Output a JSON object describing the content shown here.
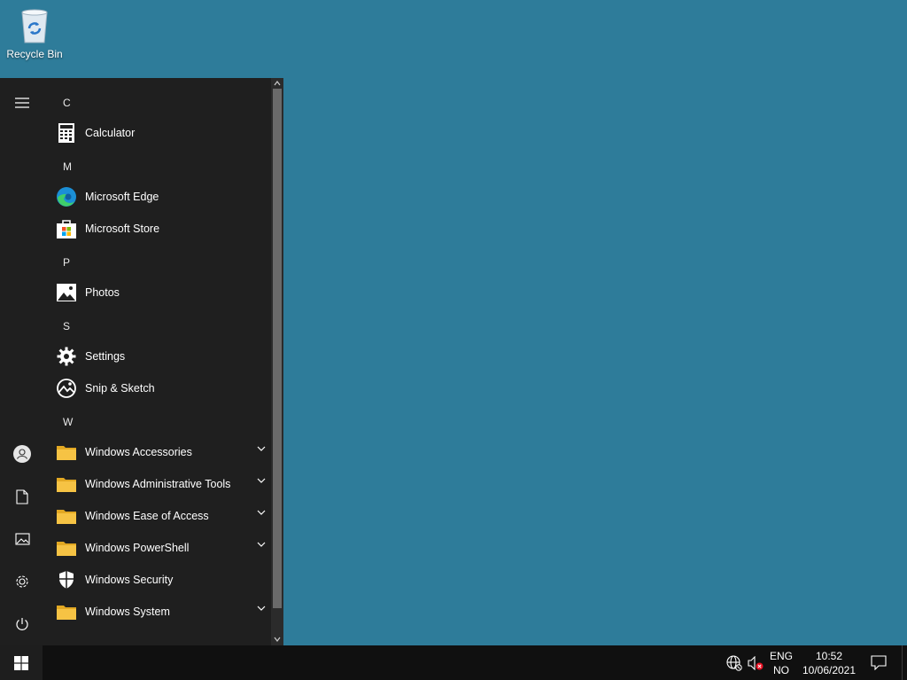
{
  "desktop": {
    "icons": [
      {
        "label": "Recycle Bin",
        "icon": "recycle-bin-icon"
      }
    ]
  },
  "start_menu": {
    "rail": [
      {
        "name": "expand",
        "icon": "hamburger-menu-icon"
      },
      {
        "name": "account",
        "icon": "user-icon"
      },
      {
        "name": "documents",
        "icon": "document-icon"
      },
      {
        "name": "pictures",
        "icon": "picture-icon"
      },
      {
        "name": "settings",
        "icon": "gear-icon"
      },
      {
        "name": "power",
        "icon": "power-icon"
      }
    ],
    "groups": [
      {
        "letter": "C",
        "apps": [
          {
            "label": "Calculator",
            "icon": "calculator-icon"
          }
        ]
      },
      {
        "letter": "M",
        "apps": [
          {
            "label": "Microsoft Edge",
            "icon": "edge-icon"
          },
          {
            "label": "Microsoft Store",
            "icon": "store-icon"
          }
        ]
      },
      {
        "letter": "P",
        "apps": [
          {
            "label": "Photos",
            "icon": "photos-icon"
          }
        ]
      },
      {
        "letter": "S",
        "apps": [
          {
            "label": "Settings",
            "icon": "gear-icon"
          },
          {
            "label": "Snip & Sketch",
            "icon": "snip-sketch-icon"
          }
        ]
      },
      {
        "letter": "W",
        "apps": [
          {
            "label": "Windows Accessories",
            "icon": "folder-icon",
            "expandable": true
          },
          {
            "label": "Windows Administrative Tools",
            "icon": "folder-icon",
            "expandable": true
          },
          {
            "label": "Windows Ease of Access",
            "icon": "folder-icon",
            "expandable": true
          },
          {
            "label": "Windows PowerShell",
            "icon": "folder-icon",
            "expandable": true
          },
          {
            "label": "Windows Security",
            "icon": "shield-icon"
          },
          {
            "label": "Windows System",
            "icon": "folder-icon",
            "expandable": true
          }
        ]
      }
    ]
  },
  "taskbar": {
    "start_icon": "windows-logo-icon",
    "tray_icons": [
      "network-globe-icon",
      "volume-muted-icon"
    ],
    "language": {
      "line1": "ENG",
      "line2": "NO"
    },
    "clock": {
      "time": "10:52",
      "date": "10/06/2021"
    },
    "notifications_icon": "action-center-icon"
  },
  "colors": {
    "desktop": "#2e7c9a",
    "menu_bg": "#1f1f1f",
    "taskbar": "#101010",
    "folder": "#f3c033"
  }
}
